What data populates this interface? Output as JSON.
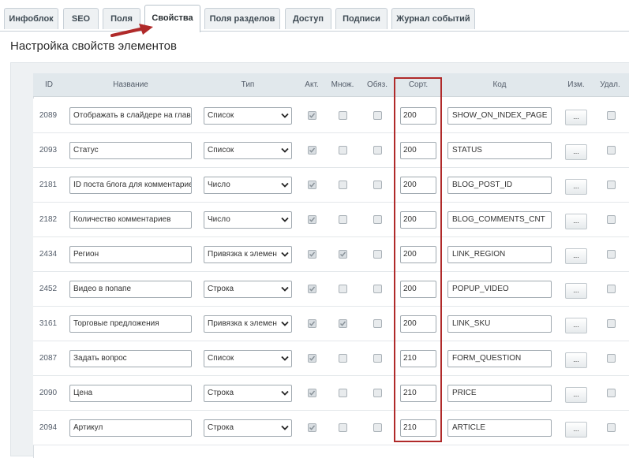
{
  "tabs": [
    {
      "label": "Инфоблок"
    },
    {
      "label": "SEO"
    },
    {
      "label": "Поля"
    },
    {
      "label": "Свойства",
      "active": true
    },
    {
      "label": "Поля разделов"
    },
    {
      "label": "Доступ"
    },
    {
      "label": "Подписи"
    },
    {
      "label": "Журнал событий"
    }
  ],
  "section": {
    "title": "Настройка свойств элементов"
  },
  "columns": {
    "id": "ID",
    "name": "Название",
    "type": "Тип",
    "active": "Акт.",
    "multiple": "Множ.",
    "required": "Обяз.",
    "sort": "Сорт.",
    "code": "Код",
    "edit": "Изм.",
    "delete": "Удал."
  },
  "rows": [
    {
      "id": "2089",
      "name": "Отображать в слайдере на глав",
      "type": "Список",
      "active": true,
      "multiple": false,
      "required": false,
      "sort": "200",
      "code": "SHOW_ON_INDEX_PAGE",
      "edit": "...",
      "delete": false
    },
    {
      "id": "2093",
      "name": "Статус",
      "type": "Список",
      "active": true,
      "multiple": false,
      "required": false,
      "sort": "200",
      "code": "STATUS",
      "edit": "...",
      "delete": false
    },
    {
      "id": "2181",
      "name": "ID поста блога для комментарие",
      "type": "Число",
      "active": true,
      "multiple": false,
      "required": false,
      "sort": "200",
      "code": "BLOG_POST_ID",
      "edit": "...",
      "delete": false
    },
    {
      "id": "2182",
      "name": "Количество комментариев",
      "type": "Число",
      "active": true,
      "multiple": false,
      "required": false,
      "sort": "200",
      "code": "BLOG_COMMENTS_CNT",
      "edit": "...",
      "delete": false
    },
    {
      "id": "2434",
      "name": "Регион",
      "type": "Привязка к элемен",
      "active": true,
      "multiple": true,
      "required": false,
      "sort": "200",
      "code": "LINK_REGION",
      "edit": "...",
      "delete": false
    },
    {
      "id": "2452",
      "name": "Видео в попапе",
      "type": "Строка",
      "active": true,
      "multiple": false,
      "required": false,
      "sort": "200",
      "code": "POPUP_VIDEO",
      "edit": "...",
      "delete": false
    },
    {
      "id": "3161",
      "name": "Торговые предложения",
      "type": "Привязка к элемен",
      "active": true,
      "multiple": true,
      "required": false,
      "sort": "200",
      "code": "LINK_SKU",
      "edit": "...",
      "delete": false
    },
    {
      "id": "2087",
      "name": "Задать вопрос",
      "type": "Список",
      "active": true,
      "multiple": false,
      "required": false,
      "sort": "210",
      "code": "FORM_QUESTION",
      "edit": "...",
      "delete": false
    },
    {
      "id": "2090",
      "name": "Цена",
      "type": "Строка",
      "active": true,
      "multiple": false,
      "required": false,
      "sort": "210",
      "code": "PRICE",
      "edit": "...",
      "delete": false
    },
    {
      "id": "2094",
      "name": "Артикул",
      "type": "Строка",
      "active": true,
      "multiple": false,
      "required": false,
      "sort": "210",
      "code": "ARTICLE",
      "edit": "...",
      "delete": false
    }
  ],
  "colors": {
    "highlight": "#b02a2a",
    "arrow": "#b02a2a",
    "header_bg": "#e1e8ec"
  }
}
